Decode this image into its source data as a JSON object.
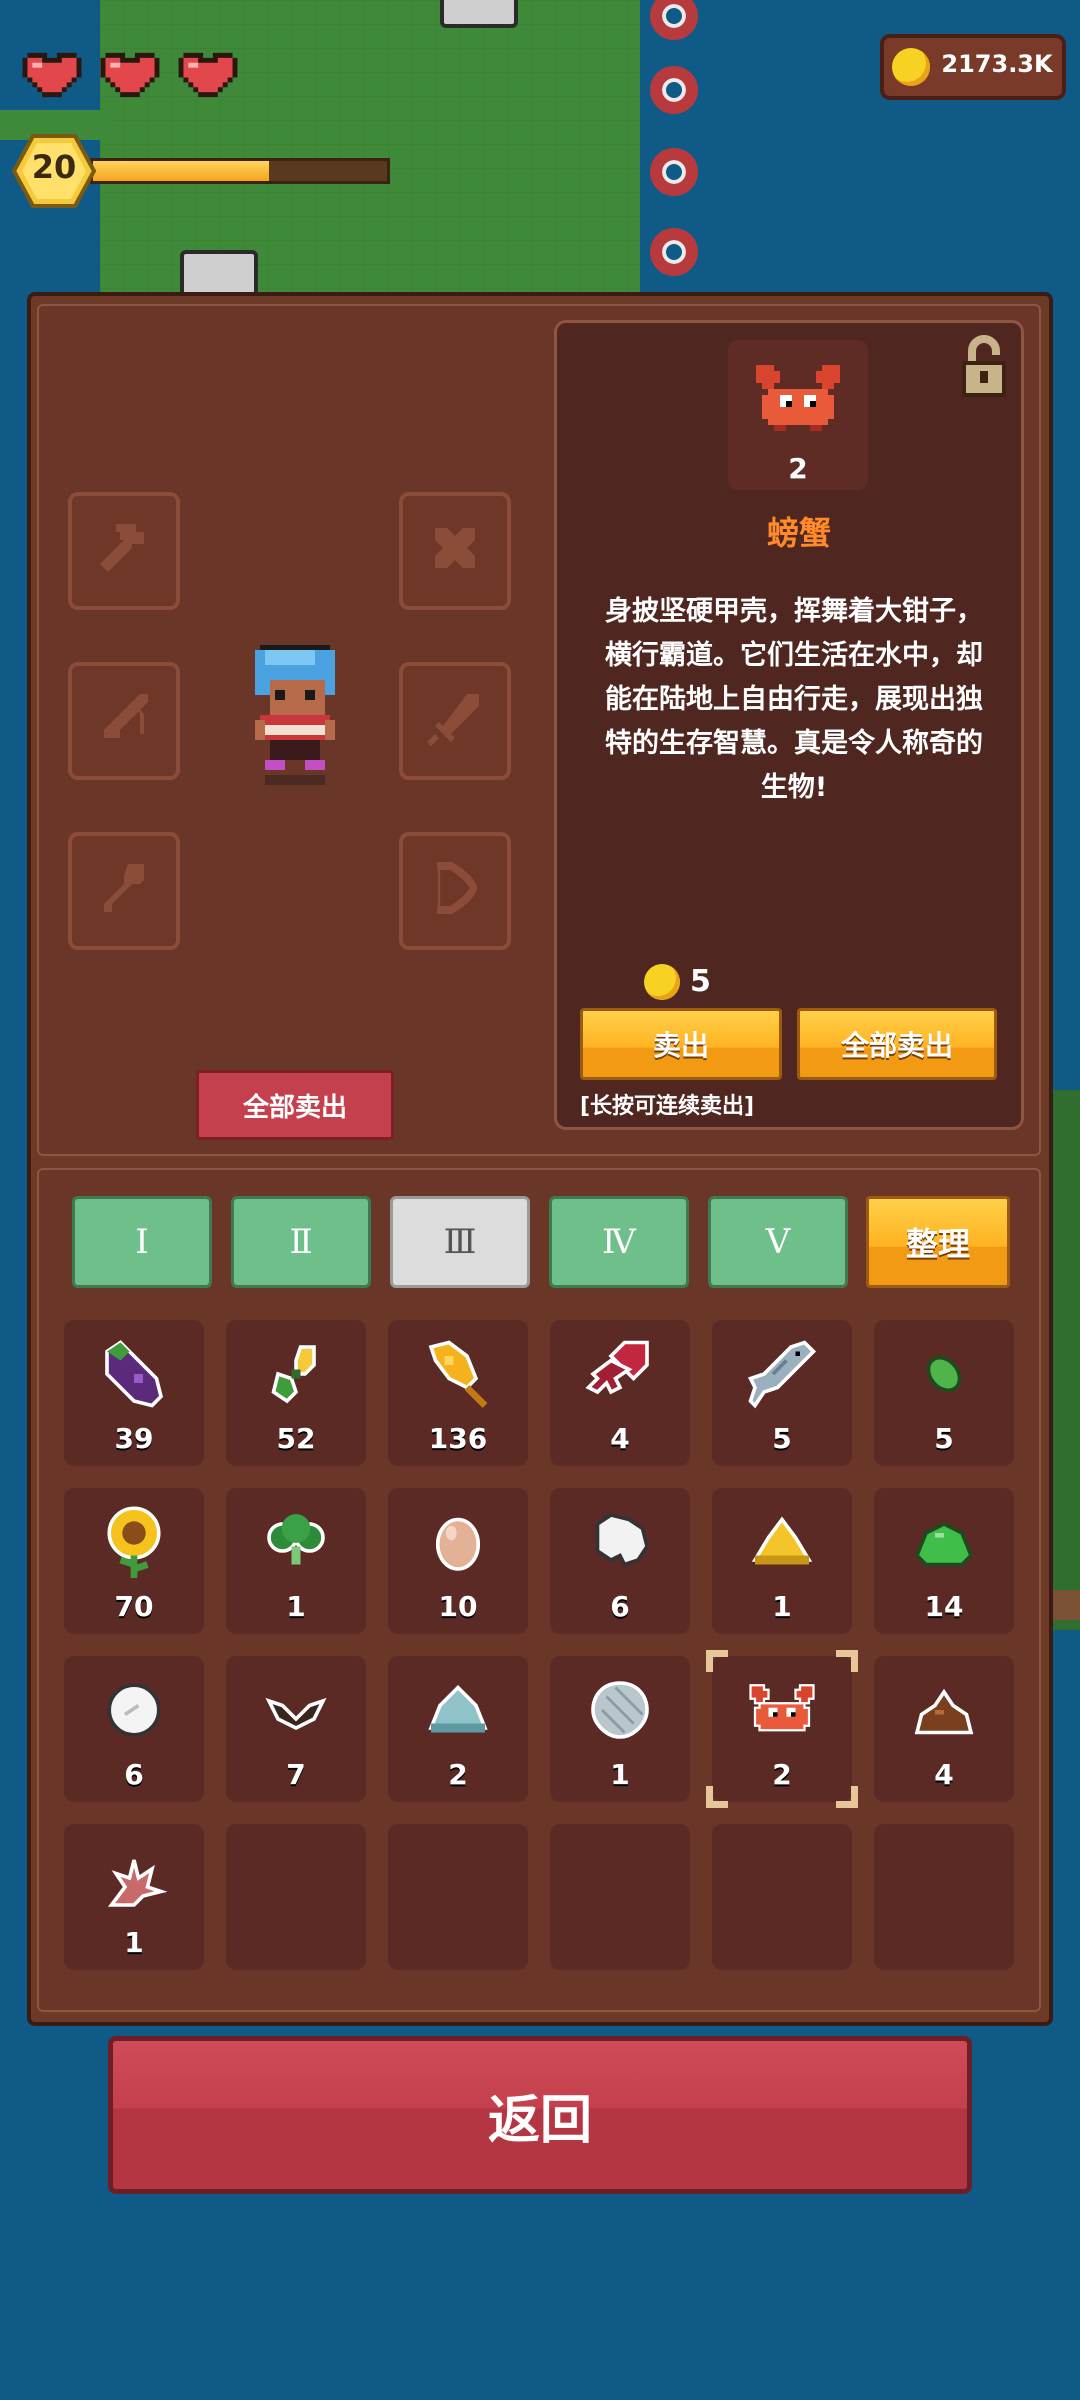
{
  "hud": {
    "hearts": 3,
    "level": "20",
    "xp_fraction": 0.6,
    "coins": "2173.3K"
  },
  "equipment": {
    "slots_left": [
      "axe-slot",
      "fishing-rod-slot",
      "shovel-slot"
    ],
    "slots_right": [
      "pickaxe-slot",
      "sword-slot",
      "bow-slot"
    ],
    "sell_all_label": "全部卖出"
  },
  "detail": {
    "icon": "crab-icon",
    "count": "2",
    "name": "螃蟹",
    "description": "身披坚硬甲壳，挥舞着大钳子，横行霸道。它们生活在水中，却能在陆地上自由行走，展现出独特的生存智慧。真是令人称奇的生物!",
    "price": "5",
    "sell_label": "卖出",
    "sell_all_label": "全部卖出",
    "hint": "[长按可连续卖出]"
  },
  "tabs": [
    "Ⅰ",
    "Ⅱ",
    "Ⅲ",
    "Ⅳ",
    "Ⅴ"
  ],
  "active_tab": 2,
  "sort_label": "整理",
  "inventory": [
    {
      "icon": "eggplant-icon",
      "count": "39"
    },
    {
      "icon": "corn-seedling-icon",
      "count": "52"
    },
    {
      "icon": "wheat-icon",
      "count": "136"
    },
    {
      "icon": "squid-icon",
      "count": "4"
    },
    {
      "icon": "fish-icon",
      "count": "5"
    },
    {
      "icon": "green-seed-icon",
      "count": "5"
    },
    {
      "icon": "sunflower-icon",
      "count": "70"
    },
    {
      "icon": "broccoli-icon",
      "count": "1"
    },
    {
      "icon": "egg-icon",
      "count": "10"
    },
    {
      "icon": "wool-icon",
      "count": "6"
    },
    {
      "icon": "gold-pile-icon",
      "count": "1"
    },
    {
      "icon": "green-slime-icon",
      "count": "14"
    },
    {
      "icon": "cotton-icon",
      "count": "6"
    },
    {
      "icon": "bat-wing-icon",
      "count": "7"
    },
    {
      "icon": "blue-slime-icon",
      "count": "2"
    },
    {
      "icon": "shell-icon",
      "count": "1"
    },
    {
      "icon": "crab-icon",
      "count": "2"
    },
    {
      "icon": "dung-icon",
      "count": "4"
    },
    {
      "icon": "coral-icon",
      "count": "1"
    },
    {
      "icon": "",
      "count": ""
    },
    {
      "icon": "",
      "count": ""
    },
    {
      "icon": "",
      "count": ""
    },
    {
      "icon": "",
      "count": ""
    },
    {
      "icon": "",
      "count": ""
    }
  ],
  "selected_index": 16,
  "back_label": "返回",
  "colors": {
    "panel": "#6d3a27",
    "accent_orange": "#ffb322",
    "button_red": "#c4404d",
    "tab_green": "#6fbf8a",
    "name_orange": "#ff8a2a"
  }
}
